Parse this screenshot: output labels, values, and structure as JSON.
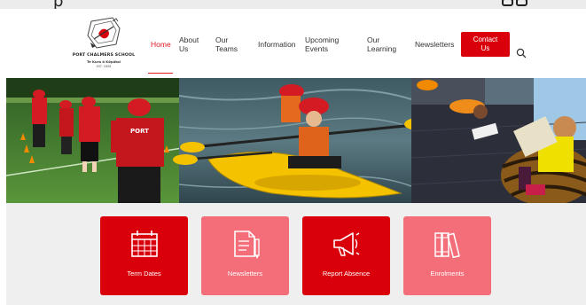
{
  "top_strip": {
    "cut_text": "p"
  },
  "school": {
    "name": "PORT CHALMERS SCHOOL",
    "subtitle": "Te Kura ō Kōpūtai",
    "est": "EST. 1856"
  },
  "nav": {
    "home": "Home",
    "about_line1": "About",
    "about_line2": "Us",
    "teams_line1": "Our",
    "teams_line2": "Teams",
    "information": "Information",
    "events_line1": "Upcoming",
    "events_line2": "Events",
    "learning_line1": "Our",
    "learning_line2": "Learning",
    "newsletters": "Newsletters",
    "contact_line1": "Contact",
    "contact_line2": "Us"
  },
  "hero": {
    "shirt_text": "PORT"
  },
  "quick_links": [
    {
      "label": "Term Dates",
      "icon": "calendar-icon"
    },
    {
      "label": "Newsletters",
      "icon": "document-pencil-icon"
    },
    {
      "label": "Report Absence",
      "icon": "megaphone-icon"
    },
    {
      "label": "Enrolments",
      "icon": "books-icon"
    }
  ],
  "colors": {
    "brand_red": "#d9000c",
    "tile_pink": "#f46e79",
    "nav_active": "#e01b22"
  }
}
